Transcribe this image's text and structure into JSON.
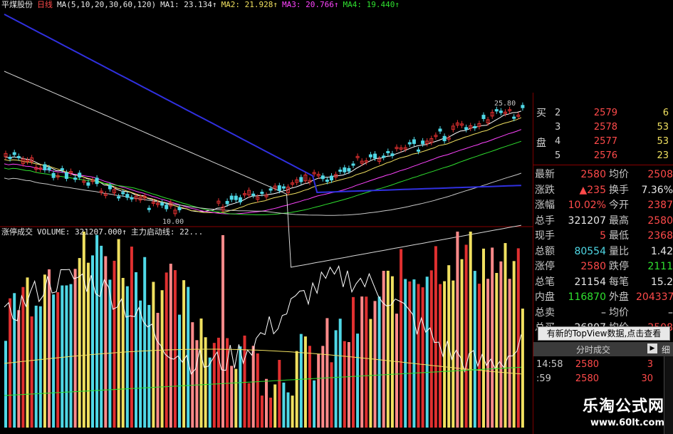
{
  "price_header": {
    "stock_name": "平煤股份",
    "period": "日线",
    "ma_def": "MA(5,10,20,30,60,120)",
    "ma1": "MA1: 23.134↑",
    "ma2": "MA2: 21.928↑",
    "ma3": "MA3: 20.766↑",
    "ma4": "MA4: 19.440↑"
  },
  "price_labels": {
    "high": "25.80",
    "low": "10.00"
  },
  "volume_header": {
    "indicator": "涨停成交",
    "volume": "VOLUME: 321207.000↑",
    "line": "主力启动线: 22..."
  },
  "order_book": {
    "buy_side_label_1": "买",
    "buy_side_label_2": "盘",
    "rows": [
      {
        "level": "2",
        "price": "2579",
        "vol": "6"
      },
      {
        "level": "3",
        "price": "2578",
        "vol": "53"
      },
      {
        "level": "4",
        "price": "2577",
        "vol": "53"
      },
      {
        "level": "5",
        "price": "2576",
        "vol": "23"
      }
    ]
  },
  "quotes": [
    {
      "l": "最新",
      "lv": "2580",
      "lc": "red",
      "r": "均价",
      "rv": "2508",
      "rc": "red"
    },
    {
      "l": "涨跌",
      "lv": "▲235",
      "lc": "red",
      "r": "换手",
      "rv": "7.36%",
      "rc": "wht"
    },
    {
      "l": "涨幅",
      "lv": "10.02%",
      "lc": "red",
      "r": "今开",
      "rv": "2387",
      "rc": "red"
    },
    {
      "l": "总手",
      "lv": "321207",
      "lc": "wht",
      "r": "最高",
      "rv": "2580",
      "rc": "red"
    },
    {
      "l": "现手",
      "lv": "5",
      "lc": "red",
      "r": "最低",
      "rv": "2368",
      "rc": "red"
    },
    {
      "l": "总额",
      "lv": "80554",
      "lc": "cyan",
      "r": "量比",
      "rv": "1.42",
      "rc": "wht"
    },
    {
      "l": "涨停",
      "lv": "2580",
      "lc": "red",
      "r": "跌停",
      "rv": "2111",
      "rc": "grn"
    },
    {
      "l": "总笔",
      "lv": "21154",
      "lc": "wht",
      "r": "每笔",
      "rv": "15.2",
      "rc": "wht"
    },
    {
      "l": "内盘",
      "lv": "116870",
      "lc": "grn",
      "r": "外盘",
      "rv": "204337",
      "rc": "red"
    },
    {
      "l": "总卖",
      "lv": "–",
      "lc": "wht",
      "r": "均价",
      "rv": "–",
      "rc": "wht"
    },
    {
      "l": "总买",
      "lv": "26807",
      "lc": "wht",
      "r": "均价",
      "rv": "2508",
      "rc": "red"
    }
  ],
  "notice": "有新的TopView数据,点击查看",
  "ticks_tab": {
    "title": "分时成交",
    "detail": "细"
  },
  "ticks": [
    {
      "time": "14:58",
      "price": "2580",
      "vol": "3"
    },
    {
      "time": ":59",
      "price": "2580",
      "vol": "30"
    }
  ],
  "watermark": {
    "title": "乐淘公式网",
    "url": "www.60lt.com"
  },
  "colors": {
    "up": "#ff4a4a",
    "down": "#2fe02f",
    "up_candle": "#e03030",
    "down_candle": "#4fd8e6",
    "ma1": "#ffffff",
    "ma2": "#f0e060",
    "ma3": "#ff44ff",
    "ma4": "#2fe02f",
    "ma5": "#c8c8c8",
    "ma6": "#3030e0"
  },
  "chart_data": {
    "type": "candlestick+volume",
    "price_high_label": 25.8,
    "price_low_label": 10.0,
    "last_close": 25.8,
    "volume_last": 321207
  }
}
